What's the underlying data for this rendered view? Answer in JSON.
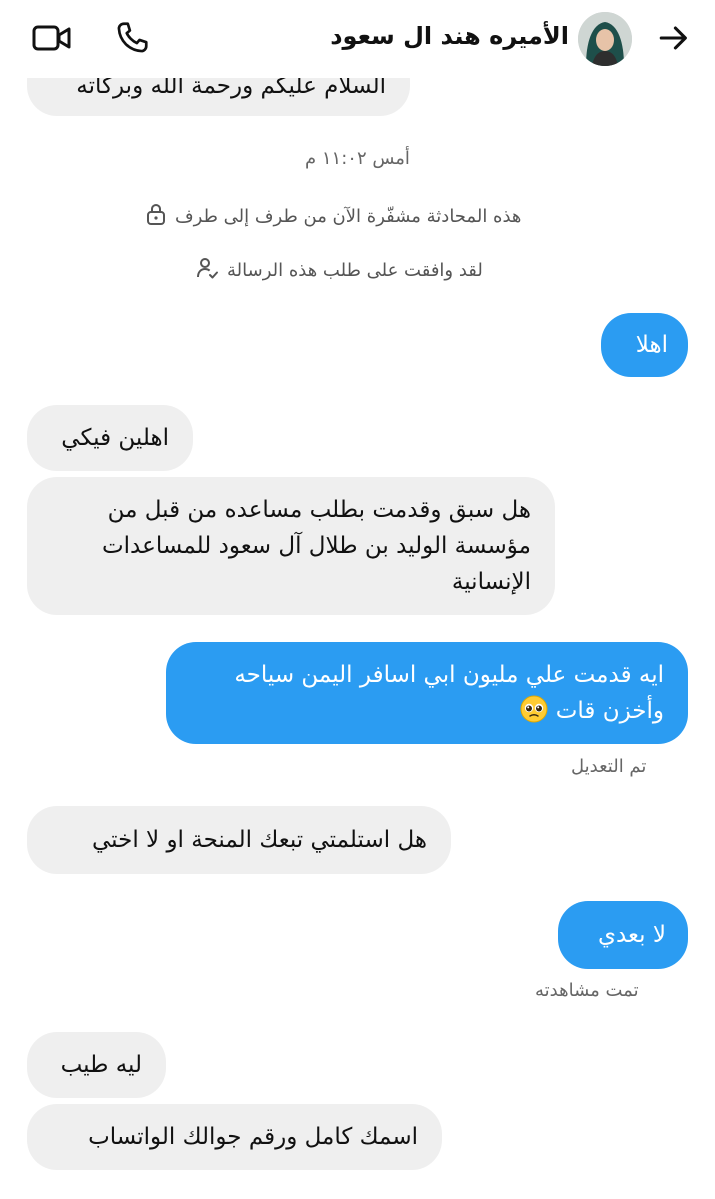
{
  "header": {
    "contact_name": "الأميره هند ال سعود",
    "icons": {
      "back": "arrow-right-icon",
      "video": "video-camera-icon",
      "call": "phone-icon"
    }
  },
  "system": {
    "timestamp": "أمس ١١:٠٢ م",
    "encrypted_notice": "هذه المحادثة مشفّرة الآن من طرف إلى طرف",
    "accepted_notice": "لقد وافقت على طلب هذه الرسالة"
  },
  "messages": {
    "m0": "السلام عليكم ورحمة الله وبركاته",
    "m1": "اهلا",
    "m2": "اهلين فيكي",
    "m3_l1": "هل سبق وقدمت بطلب مساعده من قبل من",
    "m3_l2": "مؤسسة الوليد بن طلال آل سعود للمساعدات",
    "m3_l3": "الإنسانية",
    "m4_l1": "ايه قدمت علي مليون ابي اسافر اليمن سياحه",
    "m4_l2": "وأخزن قات",
    "m4_edited": "تم التعديل",
    "m5": "هل استلمتي تبعك المنحة او لا اختي",
    "m6": "لا بعدي",
    "m6_seen": "تمت مشاهدته",
    "m7": "ليه طيب",
    "m8": "اسمك كامل ورقم جوالك الواتساب"
  },
  "colors": {
    "outgoing_bubble": "#2b9cf2",
    "incoming_bubble": "#efefef"
  }
}
